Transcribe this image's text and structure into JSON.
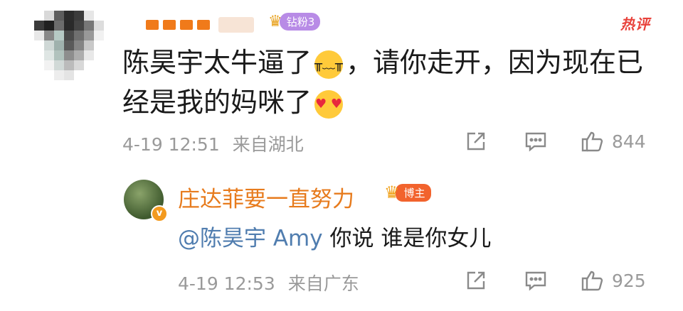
{
  "comment": {
    "badge_label": "钻粉3",
    "hot_label": "热评",
    "text_part1": "陈昊宇太牛逼了",
    "text_part2": "，请你走开，因为现在已",
    "text_part3": "经是我的妈咪了",
    "time": "4-19 12:51",
    "location": "来自湖北",
    "like_count": "844"
  },
  "reply": {
    "author": "庄达菲要一直努力",
    "badge_label": "博主",
    "verified_mark": "v",
    "mention": "@陈昊宇 Amy",
    "text": " 你说 谁是你女儿",
    "time": "4-19 12:53",
    "location": "来自广东",
    "like_count": "925"
  },
  "icons": {
    "share": "share-icon",
    "comment": "comment-icon",
    "like": "thumbs-up-icon",
    "crying": "crying-emoji-icon",
    "heart_eyes": "heart-eyes-emoji-icon"
  },
  "colors": {
    "username_orange": "#e77b1d",
    "mention_blue": "#507daf",
    "meta_gray": "#9a9a9a",
    "hot_red": "#e8423b",
    "fan_badge_purple": "#b88be6",
    "blogger_badge_red": "#f2632d"
  }
}
